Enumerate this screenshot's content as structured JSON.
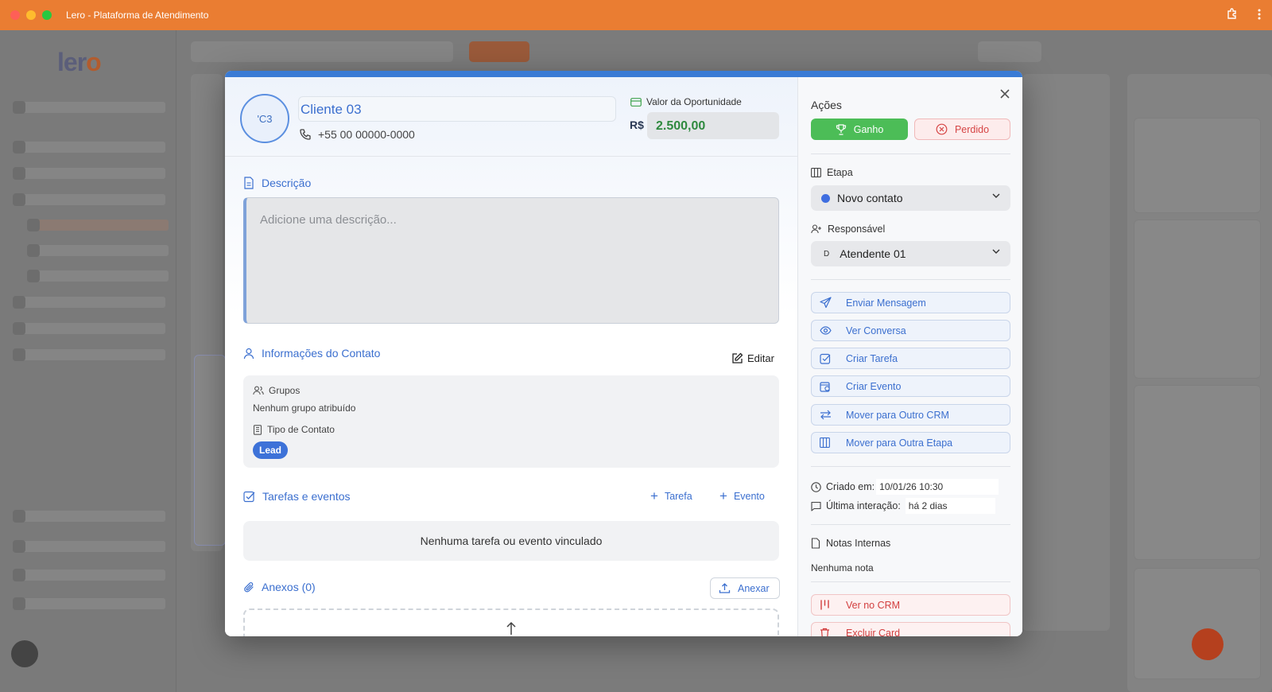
{
  "window": {
    "title": "Lero - Plataforma de Atendimento"
  },
  "background": {
    "logo_main": "ler",
    "logo_accent": "o"
  },
  "contact": {
    "avatar_initials": "'C3",
    "name": "Cliente 03",
    "phone": "+55 00 00000-0000",
    "opportunity_label": "Valor da Oportunidade",
    "currency": "R$",
    "opportunity_value": "2.500,00"
  },
  "description": {
    "title": "Descrição",
    "placeholder": "Adicione uma descrição..."
  },
  "contact_info": {
    "title": "Informações do Contato",
    "edit_label": "Editar",
    "groups_label": "Grupos",
    "groups_value": "Nenhum grupo atribuído",
    "type_label": "Tipo de Contato",
    "type_badge": "Lead"
  },
  "tasks": {
    "title": "Tarefas e eventos",
    "add_task": "Tarefa",
    "add_event": "Evento",
    "empty": "Nenhuma tarefa ou evento vinculado"
  },
  "attachments": {
    "title": "Anexos (0)",
    "attach_label": "Anexar"
  },
  "actions": {
    "title": "Ações",
    "won": "Ganho",
    "lost": "Perdido",
    "stage_label": "Etapa",
    "stage_value": "Novo contato",
    "owner_label": "Responsável",
    "owner_initial": "D",
    "owner_value": "Atendente 01",
    "buttons": [
      "Enviar Mensagem",
      "Ver Conversa",
      "Criar Tarefa",
      "Criar Evento",
      "Mover para Outro CRM",
      "Mover para Outra Etapa"
    ],
    "created_label": "Criado em:",
    "created_value": "10/01/26 10:30",
    "last_label": "Última interação:",
    "last_value": "há 2 dias",
    "notes_label": "Notas Internas",
    "notes_value": "Nenhuma nota",
    "view_crm": "Ver no CRM",
    "delete_card": "Excluir Card"
  },
  "colors": {
    "titlebar": "#ea7d32",
    "accent_blue": "#3b6fcf",
    "won_green": "#4cbd57",
    "lost_red": "#d64545",
    "value_green": "#2f8a3f"
  }
}
